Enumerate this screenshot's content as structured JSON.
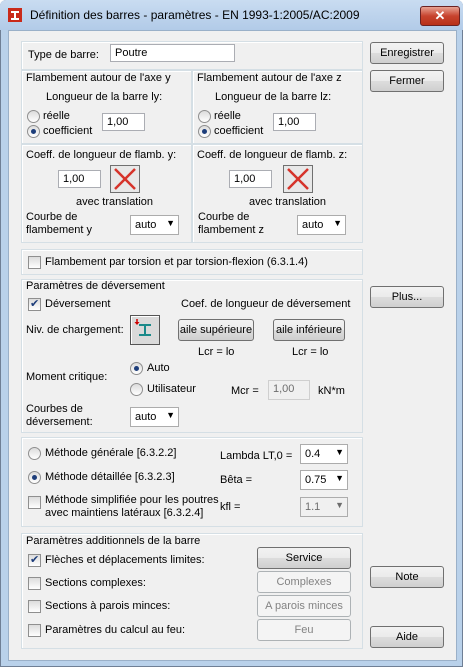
{
  "window": {
    "title": "Définition des barres - paramètres - EN 1993-1:2005/AC:2009",
    "close_symbol": "✕"
  },
  "type_barre": {
    "label": "Type de barre:",
    "value": "Poutre"
  },
  "side_buttons": {
    "enregistrer": "Enregistrer",
    "fermer": "Fermer",
    "plus": "Plus...",
    "note": "Note",
    "aide": "Aide"
  },
  "flamb_y": {
    "title": "Flambement autour de l'axe y",
    "subtitle": "Longueur de la barre ly:",
    "reelle": "réelle",
    "coefficient": "coefficient",
    "value": "1,00"
  },
  "flamb_z": {
    "title": "Flambement autour de l'axe z",
    "subtitle": "Longueur de la barre lz:",
    "reelle": "réelle",
    "coefficient": "coefficient",
    "value": "1,00"
  },
  "coeff_y": {
    "title": "Coeff. de longueur de flamb. y:",
    "value": "1,00",
    "translation": "avec translation",
    "courbe_1": "Courbe de",
    "courbe_2": "flambement  y",
    "courbe_value": "auto"
  },
  "coeff_z": {
    "title": "Coeff. de longueur de flamb. z:",
    "value": "1,00",
    "translation": "avec translation",
    "courbe_1": "Courbe de",
    "courbe_2": "flambement  z",
    "courbe_value": "auto"
  },
  "torsion": {
    "label": "Flambement par torsion et par torsion-flexion (6.3.1.4)"
  },
  "deversement": {
    "group_title": "Paramètres de déversement",
    "check_label": "Déversement",
    "coef_title": "Coef. de longueur de déversement",
    "niv_label": "Niv. de chargement:",
    "aile_sup": "aile supérieure",
    "aile_inf": "aile inférieure",
    "lcr_sup": "Lcr =  lo",
    "lcr_inf": "Lcr =  lo",
    "moment_label": "Moment critique:",
    "auto": "Auto",
    "utilisateur": "Utilisateur",
    "mcr_label": "Mcr =",
    "mcr_value": "1,00",
    "mcr_unit": "kN*m",
    "courbes_1": "Courbes de",
    "courbes_2": "déversement:",
    "courbes_value": "auto"
  },
  "methodes": {
    "generale": "Méthode générale   [6.3.2.2]",
    "detaillee": "Méthode détaillée   [6.3.2.3]",
    "simplifiee_1": "Méthode simplifiée pour les poutres",
    "simplifiee_2": "avec maintiens latéraux [6.3.2.4]",
    "lambda_label": "Lambda LT,0 =",
    "lambda_value": "0.4",
    "beta_label": "Bêta =",
    "beta_value": "0.75",
    "kfl_label": "kfl =",
    "kfl_value": "1.1"
  },
  "additionnels": {
    "title": "Paramètres additionnels de la barre",
    "fleches": "Flèches et déplacements limites:",
    "sections_complexes": "Sections complexes:",
    "parois_minces": "Sections à parois minces:",
    "feu": "Paramètres du calcul au feu:",
    "btn_service": "Service",
    "btn_complexes": "Complexes",
    "btn_parois": "A parois minces",
    "btn_feu": "Feu"
  }
}
